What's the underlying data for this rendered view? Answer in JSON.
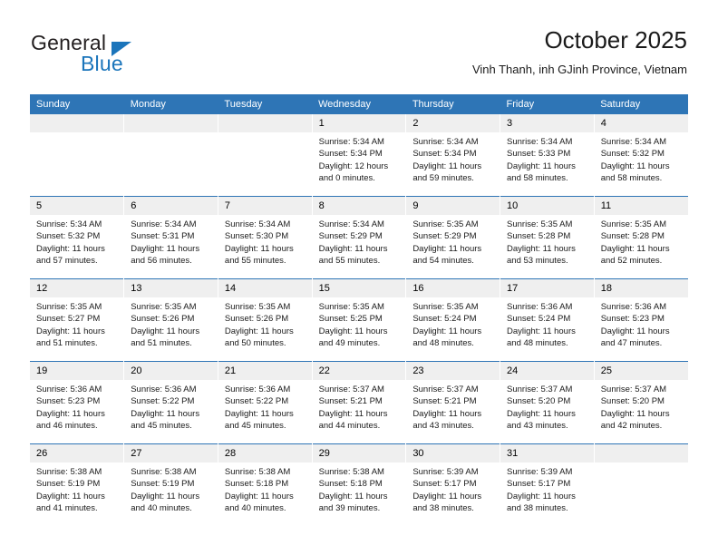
{
  "brand": {
    "word_one": "General",
    "word_two": "Blue",
    "triangle_icon": "triangle-icon",
    "accent_color": "#1b75bb"
  },
  "header": {
    "title": "October 2025",
    "subtitle": "Vinh Thanh, inh GJinh Province, Vietnam"
  },
  "theme": {
    "header_row_color": "#2e75b6",
    "daynum_band_color": "#efefef",
    "text_color": "#1a1a1a"
  },
  "weekday_headers": [
    "Sunday",
    "Monday",
    "Tuesday",
    "Wednesday",
    "Thursday",
    "Friday",
    "Saturday"
  ],
  "labels": {
    "sunrise_prefix": "Sunrise:",
    "sunset_prefix": "Sunset:",
    "daylight_prefix": "Daylight:"
  },
  "weeks": [
    [
      {
        "day": "",
        "sunrise": "",
        "sunset": "",
        "daylight_line1": "",
        "daylight_line2": ""
      },
      {
        "day": "",
        "sunrise": "",
        "sunset": "",
        "daylight_line1": "",
        "daylight_line2": ""
      },
      {
        "day": "",
        "sunrise": "",
        "sunset": "",
        "daylight_line1": "",
        "daylight_line2": ""
      },
      {
        "day": "1",
        "sunrise": "Sunrise: 5:34 AM",
        "sunset": "Sunset: 5:34 PM",
        "daylight_line1": "Daylight: 12 hours",
        "daylight_line2": "and 0 minutes."
      },
      {
        "day": "2",
        "sunrise": "Sunrise: 5:34 AM",
        "sunset": "Sunset: 5:34 PM",
        "daylight_line1": "Daylight: 11 hours",
        "daylight_line2": "and 59 minutes."
      },
      {
        "day": "3",
        "sunrise": "Sunrise: 5:34 AM",
        "sunset": "Sunset: 5:33 PM",
        "daylight_line1": "Daylight: 11 hours",
        "daylight_line2": "and 58 minutes."
      },
      {
        "day": "4",
        "sunrise": "Sunrise: 5:34 AM",
        "sunset": "Sunset: 5:32 PM",
        "daylight_line1": "Daylight: 11 hours",
        "daylight_line2": "and 58 minutes."
      }
    ],
    [
      {
        "day": "5",
        "sunrise": "Sunrise: 5:34 AM",
        "sunset": "Sunset: 5:32 PM",
        "daylight_line1": "Daylight: 11 hours",
        "daylight_line2": "and 57 minutes."
      },
      {
        "day": "6",
        "sunrise": "Sunrise: 5:34 AM",
        "sunset": "Sunset: 5:31 PM",
        "daylight_line1": "Daylight: 11 hours",
        "daylight_line2": "and 56 minutes."
      },
      {
        "day": "7",
        "sunrise": "Sunrise: 5:34 AM",
        "sunset": "Sunset: 5:30 PM",
        "daylight_line1": "Daylight: 11 hours",
        "daylight_line2": "and 55 minutes."
      },
      {
        "day": "8",
        "sunrise": "Sunrise: 5:34 AM",
        "sunset": "Sunset: 5:29 PM",
        "daylight_line1": "Daylight: 11 hours",
        "daylight_line2": "and 55 minutes."
      },
      {
        "day": "9",
        "sunrise": "Sunrise: 5:35 AM",
        "sunset": "Sunset: 5:29 PM",
        "daylight_line1": "Daylight: 11 hours",
        "daylight_line2": "and 54 minutes."
      },
      {
        "day": "10",
        "sunrise": "Sunrise: 5:35 AM",
        "sunset": "Sunset: 5:28 PM",
        "daylight_line1": "Daylight: 11 hours",
        "daylight_line2": "and 53 minutes."
      },
      {
        "day": "11",
        "sunrise": "Sunrise: 5:35 AM",
        "sunset": "Sunset: 5:28 PM",
        "daylight_line1": "Daylight: 11 hours",
        "daylight_line2": "and 52 minutes."
      }
    ],
    [
      {
        "day": "12",
        "sunrise": "Sunrise: 5:35 AM",
        "sunset": "Sunset: 5:27 PM",
        "daylight_line1": "Daylight: 11 hours",
        "daylight_line2": "and 51 minutes."
      },
      {
        "day": "13",
        "sunrise": "Sunrise: 5:35 AM",
        "sunset": "Sunset: 5:26 PM",
        "daylight_line1": "Daylight: 11 hours",
        "daylight_line2": "and 51 minutes."
      },
      {
        "day": "14",
        "sunrise": "Sunrise: 5:35 AM",
        "sunset": "Sunset: 5:26 PM",
        "daylight_line1": "Daylight: 11 hours",
        "daylight_line2": "and 50 minutes."
      },
      {
        "day": "15",
        "sunrise": "Sunrise: 5:35 AM",
        "sunset": "Sunset: 5:25 PM",
        "daylight_line1": "Daylight: 11 hours",
        "daylight_line2": "and 49 minutes."
      },
      {
        "day": "16",
        "sunrise": "Sunrise: 5:35 AM",
        "sunset": "Sunset: 5:24 PM",
        "daylight_line1": "Daylight: 11 hours",
        "daylight_line2": "and 48 minutes."
      },
      {
        "day": "17",
        "sunrise": "Sunrise: 5:36 AM",
        "sunset": "Sunset: 5:24 PM",
        "daylight_line1": "Daylight: 11 hours",
        "daylight_line2": "and 48 minutes."
      },
      {
        "day": "18",
        "sunrise": "Sunrise: 5:36 AM",
        "sunset": "Sunset: 5:23 PM",
        "daylight_line1": "Daylight: 11 hours",
        "daylight_line2": "and 47 minutes."
      }
    ],
    [
      {
        "day": "19",
        "sunrise": "Sunrise: 5:36 AM",
        "sunset": "Sunset: 5:23 PM",
        "daylight_line1": "Daylight: 11 hours",
        "daylight_line2": "and 46 minutes."
      },
      {
        "day": "20",
        "sunrise": "Sunrise: 5:36 AM",
        "sunset": "Sunset: 5:22 PM",
        "daylight_line1": "Daylight: 11 hours",
        "daylight_line2": "and 45 minutes."
      },
      {
        "day": "21",
        "sunrise": "Sunrise: 5:36 AM",
        "sunset": "Sunset: 5:22 PM",
        "daylight_line1": "Daylight: 11 hours",
        "daylight_line2": "and 45 minutes."
      },
      {
        "day": "22",
        "sunrise": "Sunrise: 5:37 AM",
        "sunset": "Sunset: 5:21 PM",
        "daylight_line1": "Daylight: 11 hours",
        "daylight_line2": "and 44 minutes."
      },
      {
        "day": "23",
        "sunrise": "Sunrise: 5:37 AM",
        "sunset": "Sunset: 5:21 PM",
        "daylight_line1": "Daylight: 11 hours",
        "daylight_line2": "and 43 minutes."
      },
      {
        "day": "24",
        "sunrise": "Sunrise: 5:37 AM",
        "sunset": "Sunset: 5:20 PM",
        "daylight_line1": "Daylight: 11 hours",
        "daylight_line2": "and 43 minutes."
      },
      {
        "day": "25",
        "sunrise": "Sunrise: 5:37 AM",
        "sunset": "Sunset: 5:20 PM",
        "daylight_line1": "Daylight: 11 hours",
        "daylight_line2": "and 42 minutes."
      }
    ],
    [
      {
        "day": "26",
        "sunrise": "Sunrise: 5:38 AM",
        "sunset": "Sunset: 5:19 PM",
        "daylight_line1": "Daylight: 11 hours",
        "daylight_line2": "and 41 minutes."
      },
      {
        "day": "27",
        "sunrise": "Sunrise: 5:38 AM",
        "sunset": "Sunset: 5:19 PM",
        "daylight_line1": "Daylight: 11 hours",
        "daylight_line2": "and 40 minutes."
      },
      {
        "day": "28",
        "sunrise": "Sunrise: 5:38 AM",
        "sunset": "Sunset: 5:18 PM",
        "daylight_line1": "Daylight: 11 hours",
        "daylight_line2": "and 40 minutes."
      },
      {
        "day": "29",
        "sunrise": "Sunrise: 5:38 AM",
        "sunset": "Sunset: 5:18 PM",
        "daylight_line1": "Daylight: 11 hours",
        "daylight_line2": "and 39 minutes."
      },
      {
        "day": "30",
        "sunrise": "Sunrise: 5:39 AM",
        "sunset": "Sunset: 5:17 PM",
        "daylight_line1": "Daylight: 11 hours",
        "daylight_line2": "and 38 minutes."
      },
      {
        "day": "31",
        "sunrise": "Sunrise: 5:39 AM",
        "sunset": "Sunset: 5:17 PM",
        "daylight_line1": "Daylight: 11 hours",
        "daylight_line2": "and 38 minutes."
      },
      {
        "day": "",
        "sunrise": "",
        "sunset": "",
        "daylight_line1": "",
        "daylight_line2": ""
      }
    ]
  ]
}
